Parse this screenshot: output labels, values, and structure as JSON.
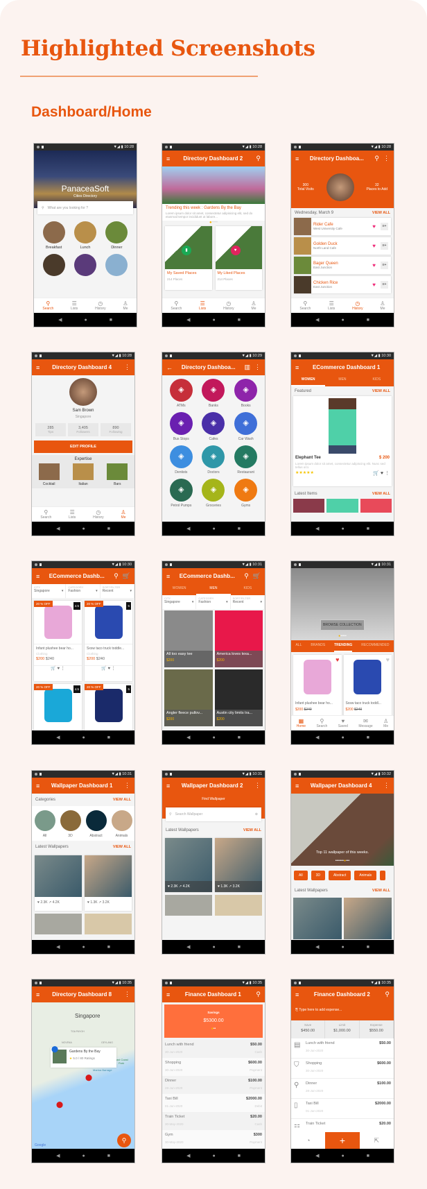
{
  "page": {
    "title": "Highlighted Screenshots",
    "section": "Dashboard/Home",
    "accent": "#e8560f"
  },
  "nav_icons": {
    "back": "◀",
    "home": "●",
    "recent": "■"
  },
  "bottom_nav": {
    "search": "Search",
    "lists": "Lists",
    "history": "History",
    "me": "Me",
    "home": "Home",
    "saved": "Saved",
    "message": "Message"
  },
  "phones": {
    "p1": {
      "time": "10:28",
      "brand": "PanaceaSoft",
      "subtitle": "Cities Directory",
      "search_placeholder": "What are you looking for ?",
      "cats": [
        "Breakfast",
        "Lunch",
        "Dinner"
      ]
    },
    "p2": {
      "time": "10:28",
      "title": "Directory Dashboard 2",
      "trending": "Trending this week : Gardens By the Bay",
      "desc": "Lorem ipsum dolor sit amet, consectetur adipisicing elit, sed do eiusmod tempor incididunt ut labore...",
      "saved": "My Saved Places",
      "liked": "My Liked Places",
      "saved_count": "214 Places",
      "liked_count": "214 Places"
    },
    "p3": {
      "time": "10:28",
      "title": "Directory Dashboa...",
      "visits": "300",
      "visits_label": "Total Visits",
      "places": "32",
      "places_label": "Places to Add",
      "date": "Wednesday, March 9",
      "view_all": "VIEW ALL",
      "items": [
        {
          "name": "Rider Cafe",
          "sub": "West University Cafe"
        },
        {
          "name": "Golden Duck",
          "sub": "North Land Cafe"
        },
        {
          "name": "Bager Queen",
          "sub": "East Junction"
        },
        {
          "name": "Chicken Rice",
          "sub": "East Junction"
        }
      ]
    },
    "p4": {
      "time": "10:28",
      "title": "Directory Dashboard 4",
      "name": "Sam Brown",
      "city": "Singapore",
      "stats": [
        {
          "v": "285",
          "l": "Tips"
        },
        {
          "v": "3,405",
          "l": "Followers"
        },
        {
          "v": "890",
          "l": "Following"
        }
      ],
      "edit": "EDIT PROFILE",
      "expertise": "Expertise",
      "exp": [
        "Cocktail",
        "Italian",
        "Bars"
      ]
    },
    "p5": {
      "time": "10:29",
      "title": "Directory Dashboa...",
      "cats": [
        {
          "l": "ATMs",
          "c": "#c62f3a"
        },
        {
          "l": "Banks",
          "c": "#c2185b"
        },
        {
          "l": "Books",
          "c": "#8e24aa"
        },
        {
          "l": "Bus Stops",
          "c": "#6a1fb0"
        },
        {
          "l": "Cafes",
          "c": "#4a2fa8"
        },
        {
          "l": "Car Wash",
          "c": "#3f6fd8"
        },
        {
          "l": "Dentists",
          "c": "#3d8ee0"
        },
        {
          "l": "Doctors",
          "c": "#2f97a8"
        },
        {
          "l": "Restaurant",
          "c": "#247a62"
        },
        {
          "l": "Petrol Pumps",
          "c": "#2a6a52"
        },
        {
          "l": "Groceries",
          "c": "#a5b51a"
        },
        {
          "l": "Gyms",
          "c": "#ef7a12"
        }
      ]
    },
    "p6": {
      "time": "10:30",
      "title": "ECommerce Dashboard 1",
      "tabs": [
        "WOMEN",
        "MEN",
        "KIDS"
      ],
      "featured": "Featured",
      "view_all": "VIEW ALL",
      "product": "Elephant Tee",
      "price": "$ 200",
      "desc": "Lorem ipsum dolor sit amet, consectetur adipiscing elit. Nunc sed tellus orci.",
      "rating": 5,
      "latest": "Latest Items"
    },
    "p7": {
      "time": "10:30",
      "title": "ECommerce Dashb...",
      "filters": [
        {
          "k": "CITY",
          "v": "Singapore"
        },
        {
          "k": "CATEGORY",
          "v": "Fashion"
        },
        {
          "k": "SORT/FILTER",
          "v": "Recent"
        }
      ],
      "items": [
        {
          "off": "20 % OFF",
          "rate": "4.5",
          "name": "Infant plushee bear ho...",
          "cat": "Clothing",
          "price": "$200",
          "old": "$240"
        },
        {
          "off": "20 % OFF",
          "rate": "5",
          "name": "Sxsw taco truck toddle...",
          "cat": "Clothing",
          "price": "$200",
          "old": "$240"
        },
        {
          "off": "20 % OFF",
          "rate": "4.5"
        },
        {
          "off": "20 % OFF",
          "rate": "5"
        }
      ]
    },
    "p8": {
      "time": "10:31",
      "title": "ECommerce Dashb...",
      "tabs": [
        "WOMEN",
        "MEN",
        "KIDS"
      ],
      "filters": [
        {
          "k": "CITY",
          "v": "Singapore"
        },
        {
          "k": "CATEGORY",
          "v": "Fashion"
        },
        {
          "k": "SORT/FILTER",
          "v": "Recent"
        }
      ],
      "items": [
        {
          "name": "All too easy tee",
          "price": "$200"
        },
        {
          "name": "America loves texa...",
          "price": "$200"
        },
        {
          "name": "Angler fleece pullov...",
          "price": "$200"
        },
        {
          "name": "Austin city limits tra...",
          "price": "$200"
        }
      ]
    },
    "p9": {
      "time": "10:31",
      "browse": "BROWSE COLLECTION",
      "tabs": [
        "ALL",
        "BRANDS",
        "TRENDING",
        "RECOMMENDED"
      ],
      "items": [
        {
          "name": "Infant plushee bear ho...",
          "price": "$200",
          "old": "$240"
        },
        {
          "name": "Sxsw taco truck toddl...",
          "price": "$200",
          "old": "$240"
        }
      ]
    },
    "p10": {
      "time": "10:31",
      "title": "Wallpaper Dashboard 1",
      "categories": "Categories",
      "view_all": "VIEW ALL",
      "cats": [
        "All",
        "3D",
        "Abstract",
        "Animals"
      ],
      "latest": "Latest Wallpapers",
      "walls": [
        {
          "likes": "2.3K",
          "views": "4.2K"
        },
        {
          "likes": "1.3K",
          "views": "3.2K"
        }
      ]
    },
    "p11": {
      "time": "10:31",
      "title": "Wallpaper Dashboard 2",
      "find": "Find Wallpaper",
      "search_placeholder": "Search Wallpaper",
      "latest": "Latest Wallpapers",
      "view_all": "VIEW ALL",
      "walls": [
        {
          "likes": "2.3K",
          "views": "4.2K"
        },
        {
          "likes": "1.3K",
          "views": "3.2K"
        }
      ]
    },
    "p12": {
      "time": "10:32",
      "title": "Wallpaper Dashboard 4",
      "caption": "Top 11 wallpaper of this weeks.",
      "chips": [
        "All",
        "3D",
        "Abstract",
        "Animals"
      ],
      "latest": "Latest Wallpapers",
      "view_all": "VIEW ALL"
    },
    "p13": {
      "time": "10:35",
      "title": "Directory Dashboard 8",
      "city": "Singapore",
      "place": "Gardens By the Bay",
      "rating": "5.0 / 80 Ratings",
      "labels": [
        "TOA PAYOH",
        "NOVENA",
        "GEYLANG",
        "Marina Barrage",
        "East Coast Park",
        "Google"
      ]
    },
    "p14": {
      "time": "10:35",
      "title": "Finance Dashboard 1",
      "savings_label": "Savings",
      "savings": "$5300.00",
      "rows": [
        {
          "n": "Lunch with friend",
          "a": "$50.00",
          "d": "30-Jun-2020",
          "t": "Cash"
        },
        {
          "n": "Shopping",
          "a": "$600.00",
          "d": "30-Jun-2020",
          "t": "Payment"
        },
        {
          "n": "Dinner",
          "a": "$100.00",
          "d": "28-Jun-2020",
          "t": "Payment"
        },
        {
          "n": "Taxi Bill",
          "a": "$2000.00",
          "d": "01-Jun-2020",
          "t": "Debit"
        },
        {
          "n": "Train Ticket",
          "a": "$20.00",
          "d": "30-May-2020",
          "t": "Cash"
        },
        {
          "n": "Gym",
          "a": "$300",
          "d": "30-May-2020",
          "t": "Payment"
        }
      ]
    },
    "p15": {
      "time": "10:35",
      "title": "Finance Dashboard 2",
      "placeholder": "Type here to add expense...",
      "stats": [
        {
          "l": "Save",
          "v": "$450.00"
        },
        {
          "l": "Limit",
          "v": "$1,000.00"
        },
        {
          "l": "Expense",
          "v": "$550.00"
        }
      ],
      "rows": [
        {
          "n": "Lunch with friend",
          "a": "$50.00",
          "d": "30-Jun-2020"
        },
        {
          "n": "Shopping",
          "a": "$600.00",
          "d": "30-Jun-2020"
        },
        {
          "n": "Dinner",
          "a": "$100.00",
          "d": "28-Jun-2020"
        },
        {
          "n": "Taxi Bill",
          "a": "$2000.00",
          "d": "01-Jun-2020"
        },
        {
          "n": "Train Ticket",
          "a": "$20.00",
          "d": ""
        }
      ],
      "add": "+"
    }
  }
}
